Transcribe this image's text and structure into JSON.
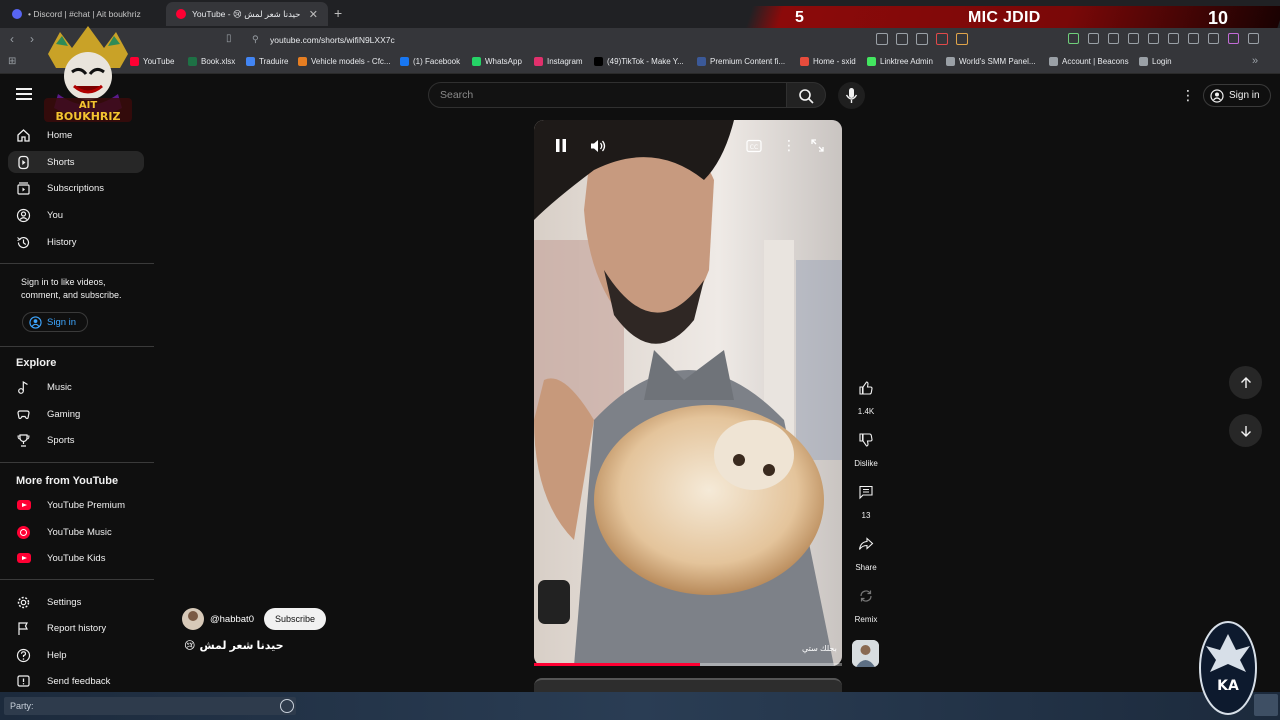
{
  "browser": {
    "tabs": [
      {
        "title": "• Discord | #chat | Ait boukhriz",
        "active": false,
        "favicon_color": "#5865f2"
      },
      {
        "title": "YouTube - 😢 حيدنا شعر لمش",
        "active": true,
        "favicon_color": "#ff0033"
      }
    ],
    "new_tab_label": "+",
    "url": "youtube.com/shorts/wifiN9LXX7c",
    "bookmarks": [
      {
        "label": "YouTube",
        "color": "#ff0033"
      },
      {
        "label": "Book.xlsx",
        "color": "#1e7145"
      },
      {
        "label": "Traduire",
        "color": "#4285f4"
      },
      {
        "label": "Vehicle models - Cfc...",
        "color": "#e67e22"
      },
      {
        "label": "(1) Facebook",
        "color": "#1877f2"
      },
      {
        "label": "WhatsApp",
        "color": "#25d366"
      },
      {
        "label": "Instagram",
        "color": "#e1306c"
      },
      {
        "label": "(49)TikTok - Make Y...",
        "color": "#000000"
      },
      {
        "label": "Premium Content fi...",
        "color": "#3b5998"
      },
      {
        "label": "Home - sxid",
        "color": "#e74c3c"
      },
      {
        "label": "Linktree Admin",
        "color": "#43e660"
      },
      {
        "label": "World's SMM Panel...",
        "color": "#9aa0a6"
      },
      {
        "label": "Account | Beacons",
        "color": "#9aa0a6"
      },
      {
        "label": "Login",
        "color": "#9aa0a6"
      }
    ]
  },
  "stream_overlay": {
    "number": "5",
    "title": "MIC JDID",
    "count": "10",
    "logo_text": "AIT BOUKHRIZ",
    "party_label": "Party:"
  },
  "header": {
    "search_placeholder": "Search",
    "sign_in": "Sign in"
  },
  "sidebar": {
    "main": [
      {
        "label": "Home",
        "icon": "home-icon"
      },
      {
        "label": "Shorts",
        "icon": "shorts-icon",
        "selected": true
      },
      {
        "label": "Subscriptions",
        "icon": "subscriptions-icon"
      },
      {
        "label": "You",
        "icon": "you-icon"
      },
      {
        "label": "History",
        "icon": "history-icon"
      }
    ],
    "signin_prompt": "Sign in to like videos, comment, and subscribe.",
    "signin_button": "Sign in",
    "explore_title": "Explore",
    "explore": [
      {
        "label": "Music",
        "icon": "music-icon"
      },
      {
        "label": "Gaming",
        "icon": "gaming-icon"
      },
      {
        "label": "Sports",
        "icon": "sports-icon"
      }
    ],
    "more_title": "More from YouTube",
    "more": [
      {
        "label": "YouTube Premium"
      },
      {
        "label": "YouTube Music"
      },
      {
        "label": "YouTube Kids"
      }
    ],
    "footer": [
      {
        "label": "Settings",
        "icon": "settings-icon"
      },
      {
        "label": "Report history",
        "icon": "flag-icon"
      },
      {
        "label": "Help",
        "icon": "help-icon"
      },
      {
        "label": "Send feedback",
        "icon": "feedback-icon"
      }
    ]
  },
  "short": {
    "channel": "@habbat0",
    "subscribe": "Subscribe",
    "title": "حيدنا شعر لمش",
    "watermark": "بحلك ستي",
    "progress": 0.54,
    "actions": {
      "likes": "1.4K",
      "dislike": "Dislike",
      "comments": "13",
      "share": "Share",
      "remix": "Remix"
    }
  }
}
